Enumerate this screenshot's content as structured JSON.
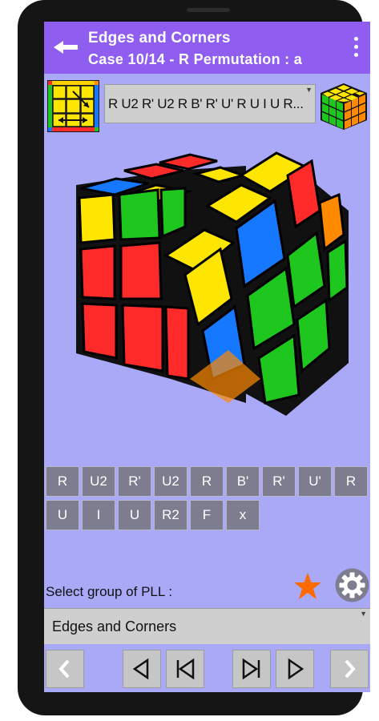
{
  "header": {
    "title": "Edges and Corners",
    "subtitle": "Case 10/14 - R Permutation : a"
  },
  "algorithm": {
    "text": "R U2 R' U2 R B' R' U' R U I U R..."
  },
  "moves": [
    "R",
    "U2",
    "R'",
    "U2",
    "R",
    "B'",
    "R'",
    "U'",
    "R",
    "U",
    "I",
    "U",
    "R2",
    "F",
    "x"
  ],
  "group_selector": {
    "label": "Select group of PLL :",
    "selected": "Edges and Corners"
  },
  "colors": {
    "appbar": "#8f5ef0",
    "background": "#a9a9f8",
    "move_button": "#7d7d8f",
    "star": "#ff6a00"
  },
  "icons": {
    "back": "back-arrow-icon",
    "menu": "more-vert-icon",
    "favorite": "star-icon",
    "settings": "gear-icon",
    "prev_page": "chevron-left-icon",
    "next_page": "chevron-right-icon",
    "step_back": "step-back-icon",
    "skip_start": "skip-to-start-icon",
    "skip_end": "skip-to-end-icon",
    "play": "play-icon"
  }
}
